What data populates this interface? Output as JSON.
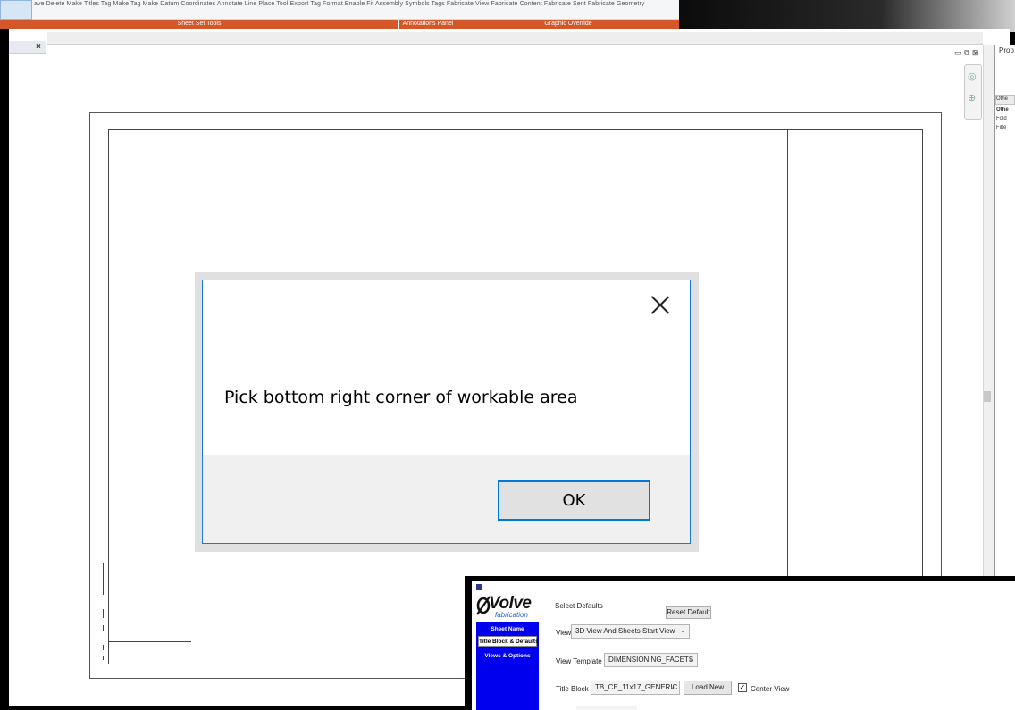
{
  "ribbon": {
    "command_text": "ave Delete Make Titles Tag Make Tag Make Datum Coordinates Annotate Line Place Tool Export Tag Format Enable Fit Assembly     Symbols     Tags        Fabricate View     Fabricate Content     Fabricate Sent     Fabricate Geometry",
    "panels": [
      {
        "label": "Sheet Set Tools"
      },
      {
        "label": "Annotations Panel"
      },
      {
        "label": "Graphic Override"
      }
    ]
  },
  "browser": {
    "close_glyph": "×"
  },
  "view_controls": {
    "glyphs": "▭ ⧉ ⊠ ⌃"
  },
  "properties": {
    "title": "Prop",
    "rows": [
      "Othe",
      "Othe",
      "Fold",
      "Filte"
    ]
  },
  "dialog": {
    "message": "Pick bottom right corner of workable area",
    "ok_label": "OK"
  },
  "fab_panel": {
    "brand": "Volve",
    "brand_sub": "fabrication",
    "nav": [
      {
        "label": "Sheet Name"
      },
      {
        "label": "Title Block & Defaults"
      },
      {
        "label": "Views & Options"
      }
    ],
    "group_label": "Select Defaults",
    "reset_label": "Reset Default",
    "view_label": "View",
    "view_value": "3D View And Sheets Start View",
    "template_label": "View Template",
    "template_value": "DIMENSIONING_FACETS",
    "titleblock_label": "Title Block",
    "titleblock_value": "TB_CE_11x17_GENERIC",
    "load_new_label": "Load New",
    "center_view_label": "Center View",
    "center_view_checked": true
  }
}
